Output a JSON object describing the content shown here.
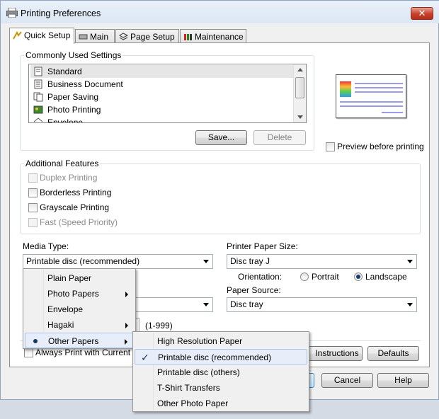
{
  "window": {
    "title": "Printing Preferences",
    "close_label": "✕"
  },
  "tabs": [
    {
      "label": "Quick Setup",
      "active": true
    },
    {
      "label": "Main",
      "active": false
    },
    {
      "label": "Page Setup",
      "active": false
    },
    {
      "label": "Maintenance",
      "active": false
    }
  ],
  "common": {
    "group_label": "Commonly Used Settings",
    "items": [
      "Standard",
      "Business Document",
      "Paper Saving",
      "Photo Printing",
      "Envelope"
    ],
    "selected_index": 0,
    "save_label": "Save...",
    "delete_label": "Delete"
  },
  "preview": {
    "checkbox_label": "Preview before printing",
    "checked": false
  },
  "features": {
    "group_label": "Additional Features",
    "items": [
      {
        "label": "Duplex Printing",
        "checked": false,
        "enabled": false
      },
      {
        "label": "Borderless Printing",
        "checked": false,
        "enabled": true
      },
      {
        "label": "Grayscale Printing",
        "checked": false,
        "enabled": true
      },
      {
        "label": "Fast (Speed Priority)",
        "checked": false,
        "enabled": false
      }
    ]
  },
  "media": {
    "label": "Media Type:",
    "value": "Printable disc (recommended)"
  },
  "paper_size": {
    "label": "Printer Paper Size:",
    "value": "Disc tray J"
  },
  "orientation": {
    "label": "Orientation:",
    "portrait": "Portrait",
    "landscape": "Landscape",
    "selected": "Landscape"
  },
  "source": {
    "label": "Paper Source:",
    "value": "Disc tray"
  },
  "copies": {
    "range": "(1-999)"
  },
  "always_print": {
    "label": "Always Print with Current Setti"
  },
  "buttons": {
    "instructions": "Instructions",
    "defaults": "Defaults",
    "cancel": "Cancel",
    "help": "Help"
  },
  "media_menu": {
    "items": [
      {
        "label": "Plain Paper",
        "submenu": false,
        "bullet": false
      },
      {
        "label": "Photo Papers",
        "submenu": true,
        "bullet": false
      },
      {
        "label": "Envelope",
        "submenu": false,
        "bullet": false
      },
      {
        "label": "Hagaki",
        "submenu": true,
        "bullet": false
      },
      {
        "label": "Other Papers",
        "submenu": true,
        "bullet": true
      }
    ]
  },
  "other_papers_menu": {
    "items": [
      {
        "label": "High Resolution Paper",
        "checked": false
      },
      {
        "label": "Printable disc (recommended)",
        "checked": true
      },
      {
        "label": "Printable disc (others)",
        "checked": false
      },
      {
        "label": "T-Shirt Transfers",
        "checked": false
      },
      {
        "label": "Other Photo Paper",
        "checked": false
      }
    ],
    "check_glyph": "✓"
  },
  "colors": {
    "highlight": "#e7eef9",
    "accent": "#14385f",
    "close": "#c7402b"
  }
}
